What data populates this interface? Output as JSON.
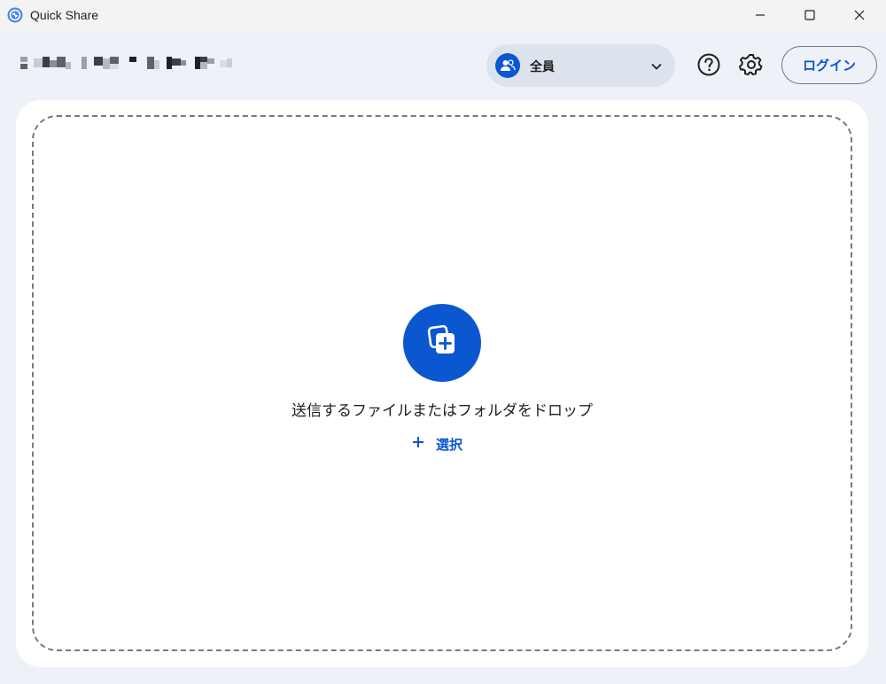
{
  "window": {
    "title": "Quick Share",
    "app_icon": "quick-share-icon",
    "controls": [
      "minimize-icon",
      "maximize-icon",
      "close-icon"
    ]
  },
  "header": {
    "device_name_redacted": true,
    "visibility": {
      "icon": "people-icon",
      "label": "全員",
      "chevron": "chevron-down-icon"
    },
    "help_icon": "help-circle-icon",
    "settings_icon": "gear-icon",
    "login_label": "ログイン"
  },
  "dropzone": {
    "icon": "add-files-icon",
    "instruction": "送信するファイルまたはフォルダをドロップ",
    "select_icon": "plus-icon",
    "select_label": "選択"
  },
  "colors": {
    "accent": "#0b57d0",
    "background": "#eef2f8",
    "card": "#ffffff",
    "pill": "#dde3ec"
  }
}
